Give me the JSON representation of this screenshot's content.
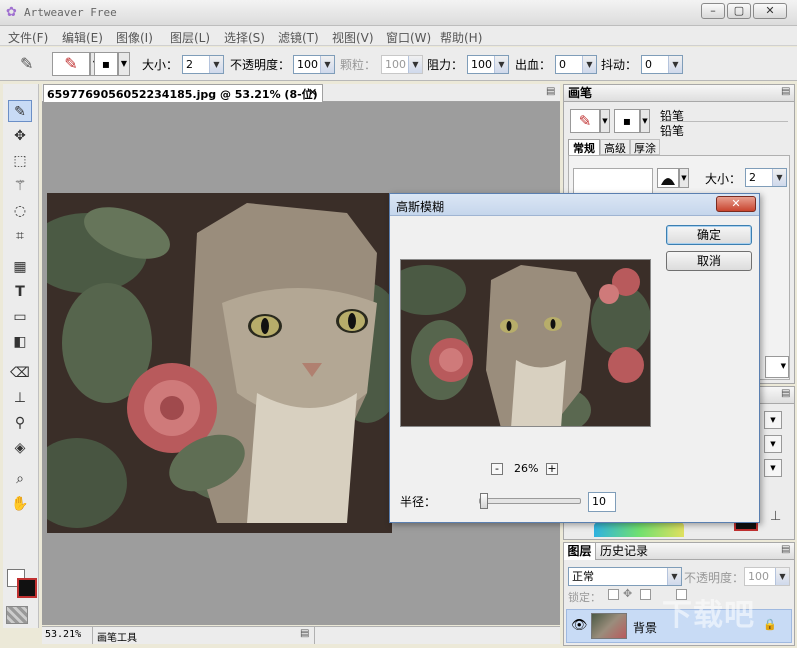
{
  "app": {
    "title": "Artweaver Free"
  },
  "menu": [
    "文件(F)",
    "编辑(E)",
    "图像(I)",
    "图层(L)",
    "选择(S)",
    "滤镜(T)",
    "视图(V)",
    "窗口(W)",
    "帮助(H)"
  ],
  "tool_options": {
    "size_label": "大小：",
    "size_value": "2",
    "opacity_label": "不透明度：",
    "opacity_value": "100",
    "grain_label": "颗粒：",
    "grain_value": "100",
    "resist_label": "阻力：",
    "resist_value": "100",
    "bleed_label": "出血：",
    "bleed_value": "0",
    "jitter_label": "抖动：",
    "jitter_value": "0"
  },
  "document": {
    "tab_title": "6597769056052234185.jpg @ 53.21% (8-位)",
    "close": "✕"
  },
  "status": {
    "zoom": "53.21%",
    "tool": "画笔工具"
  },
  "brush_panel": {
    "title": "画笔",
    "category": "铅笔",
    "variant": "铅笔",
    "tabs": [
      "常规",
      "高级",
      "厚涂"
    ],
    "size_label": "大小：",
    "size_value": "2"
  },
  "layers_panel": {
    "tabs": [
      "图层",
      "历史记录"
    ],
    "blend_mode": "正常",
    "opacity_label": "不透明度：",
    "opacity_value": "100",
    "lock_label": "锁定：",
    "layer_name": "背景"
  },
  "dialog": {
    "title": "高斯模糊",
    "ok": "确定",
    "cancel": "取消",
    "zoom": "26%",
    "zoom_minus": "-",
    "zoom_plus": "+",
    "radius_label": "半径：",
    "radius_value": "10",
    "radius_fraction": 0.02
  },
  "colors": {
    "accent": "#3c7fb1",
    "canvas_bg": "#9d9d9d",
    "selection": "#c8dbf5"
  }
}
